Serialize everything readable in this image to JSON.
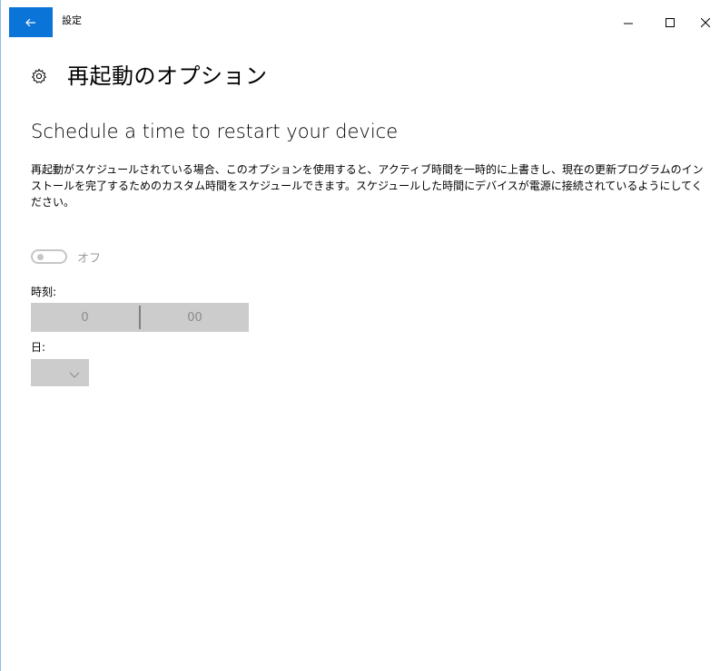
{
  "window": {
    "app_title": "設定",
    "back_icon": "arrow-left-icon",
    "minimize_icon": "minimize-icon",
    "maximize_icon": "maximize-icon",
    "close_icon": "close-icon",
    "accent_color": "#0a74d8"
  },
  "header": {
    "icon": "gear-icon",
    "title": "再起動のオプション"
  },
  "section": {
    "title": "Schedule a time to restart your device",
    "description": "再起動がスケジュールされている場合、このオプションを使用すると、アクティブ時間を一時的に上書きし、現在の更新プログラムのインストールを完了するためのカスタム時間をスケジュールできます。スケジュールした時間にデバイスが電源に接続されているようにしてください。"
  },
  "toggle": {
    "state": "off",
    "label": "オフ"
  },
  "time": {
    "label": "時刻:",
    "hour": "0",
    "minute": "00"
  },
  "day": {
    "label": "日:",
    "value": "",
    "icon": "chevron-down-icon"
  }
}
